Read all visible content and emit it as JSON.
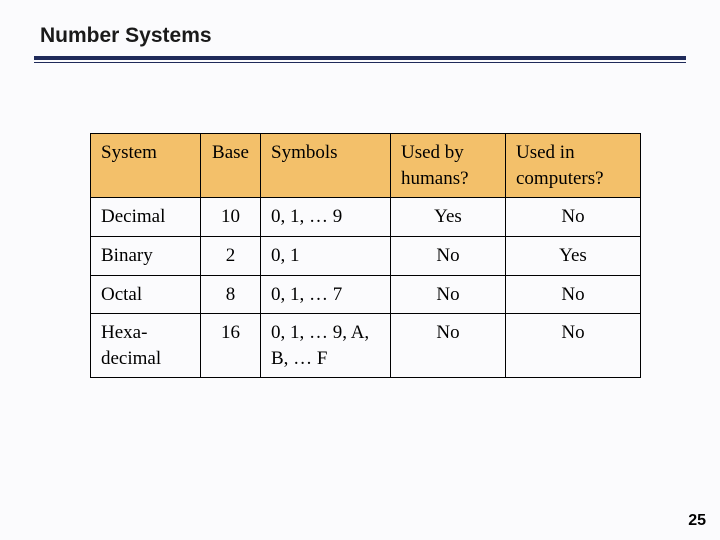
{
  "slide": {
    "title": "Number Systems",
    "page_number": "25"
  },
  "table": {
    "headers": {
      "system": "System",
      "base": "Base",
      "symbols": "Symbols",
      "humans": "Used by humans?",
      "computers": "Used in computers?"
    },
    "rows": [
      {
        "system": "Decimal",
        "base": "10",
        "symbols": "0, 1, … 9",
        "humans": "Yes",
        "computers": "No"
      },
      {
        "system": "Binary",
        "base": "2",
        "symbols": "0, 1",
        "humans": "No",
        "computers": "Yes"
      },
      {
        "system": "Octal",
        "base": "8",
        "symbols": "0, 1, … 7",
        "humans": "No",
        "computers": "No"
      },
      {
        "system": "Hexa-decimal",
        "base": "16",
        "symbols": "0, 1, … 9, A, B, … F",
        "humans": "No",
        "computers": "No"
      }
    ]
  },
  "chart_data": {
    "type": "table",
    "title": "Number Systems",
    "columns": [
      "System",
      "Base",
      "Symbols",
      "Used by humans?",
      "Used in computers?"
    ],
    "rows": [
      [
        "Decimal",
        10,
        "0, 1, … 9",
        "Yes",
        "No"
      ],
      [
        "Binary",
        2,
        "0, 1",
        "No",
        "Yes"
      ],
      [
        "Octal",
        8,
        "0, 1, … 7",
        "No",
        "No"
      ],
      [
        "Hexadecimal",
        16,
        "0, 1, … 9, A, B, … F",
        "No",
        "No"
      ]
    ]
  }
}
